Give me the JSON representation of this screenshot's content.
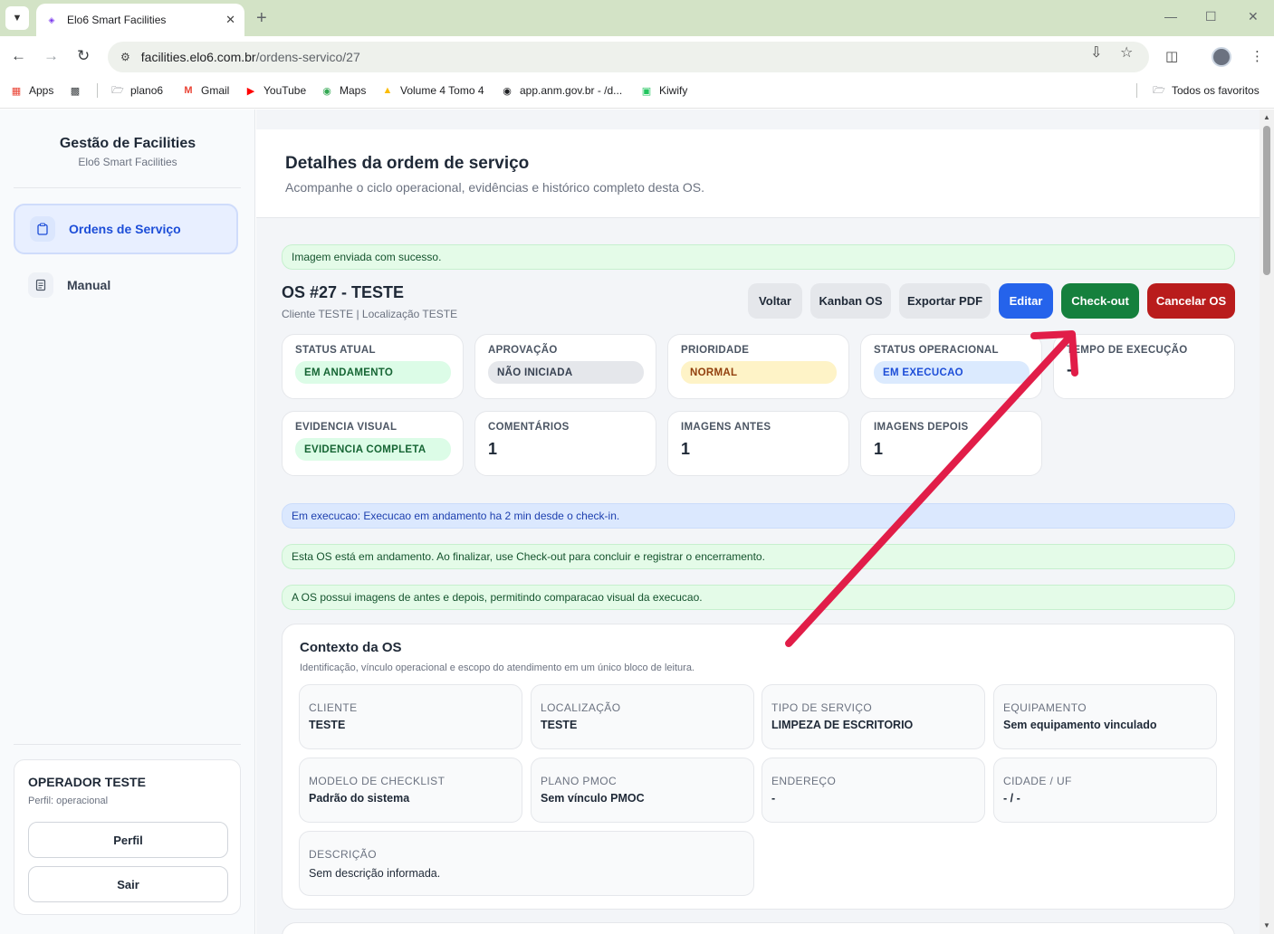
{
  "browser": {
    "tab_title": "Elo6 Smart Facilities",
    "url_host": "facilities.elo6.com.br",
    "url_path": "/ordens-servico/27",
    "bookmarks": [
      {
        "label": "Apps",
        "icon": "apps-grid-icon"
      },
      {
        "label": "",
        "icon": "grid-icon"
      },
      {
        "label": "plano6",
        "icon": "folder-icon"
      },
      {
        "label": "Gmail",
        "icon": "gmail-icon"
      },
      {
        "label": "YouTube",
        "icon": "youtube-icon"
      },
      {
        "label": "Maps",
        "icon": "maps-icon"
      },
      {
        "label": "Volume 4 Tomo 4",
        "icon": "drive-icon"
      },
      {
        "label": "app.anm.gov.br - /d...",
        "icon": "globe-icon"
      },
      {
        "label": "Kiwify",
        "icon": "kiwify-icon"
      }
    ],
    "all_bookmarks": "Todos os favoritos"
  },
  "sidebar": {
    "brand_title": "Gestão de Facilities",
    "brand_subtitle": "Elo6 Smart Facilities",
    "nav": [
      {
        "label": "Ordens de Serviço",
        "active": true
      },
      {
        "label": "Manual",
        "active": false
      }
    ],
    "operator": {
      "name": "OPERADOR TESTE",
      "role": "Perfil: operacional",
      "profile_button": "Perfil",
      "logout_button": "Sair"
    }
  },
  "header": {
    "title": "Detalhes da ordem de serviço",
    "subtitle": "Acompanhe o ciclo operacional, evidências e histórico completo desta OS."
  },
  "alerts": {
    "upload_success": "Imagem enviada com sucesso.",
    "execution": "Em execucao: Execucao em andamento ha 2 min desde o check-in.",
    "in_progress": "Esta OS está em andamento. Ao finalizar, use Check-out para concluir e registrar o encerramento.",
    "images": "A OS possui imagens de antes e depois, permitindo comparacao visual da execucao."
  },
  "os": {
    "title": "OS #27 - TESTE",
    "subtitle": "Cliente TESTE | Localização TESTE",
    "actions": {
      "back": "Voltar",
      "kanban": "Kanban OS",
      "export_pdf": "Exportar PDF",
      "edit": "Editar",
      "checkout": "Check-out",
      "cancel": "Cancelar OS"
    },
    "status_cards": [
      {
        "label": "STATUS ATUAL",
        "value": "EM ANDAMENTO",
        "color": "#dcfce7"
      },
      {
        "label": "APROVAÇÃO",
        "value": "NÃO INICIADA",
        "color": "#e5e7eb"
      },
      {
        "label": "PRIORIDADE",
        "value": "NORMAL",
        "color": "#fef3c7"
      },
      {
        "label": "STATUS OPERACIONAL",
        "value": "EM EXECUCAO",
        "color": "#dbeafe"
      },
      {
        "label": "TEMPO DE EXECUÇÃO",
        "value": "-"
      }
    ],
    "evidence_cards": [
      {
        "label": "EVIDENCIA VISUAL",
        "value": "EVIDENCIA COMPLETA"
      },
      {
        "label": "COMENTÁRIOS",
        "value": "1"
      },
      {
        "label": "IMAGENS ANTES",
        "value": "1"
      },
      {
        "label": "IMAGENS DEPOIS",
        "value": "1"
      }
    ]
  },
  "context": {
    "title": "Contexto da OS",
    "subtitle": "Identificação, vínculo operacional e escopo do atendimento em um único bloco de leitura.",
    "fields": [
      {
        "label": "CLIENTE",
        "value": "TESTE"
      },
      {
        "label": "LOCALIZAÇÃO",
        "value": "TESTE"
      },
      {
        "label": "TIPO DE SERVIÇO",
        "value": "LIMPEZA DE ESCRITORIO"
      },
      {
        "label": "EQUIPAMENTO",
        "value": "Sem equipamento vinculado"
      },
      {
        "label": "MODELO DE CHECKLIST",
        "value": "Padrão do sistema"
      },
      {
        "label": "PLANO PMOC",
        "value": "Sem vínculo PMOC"
      },
      {
        "label": "ENDEREÇO",
        "value": "-"
      },
      {
        "label": "CIDADE / UF",
        "value": "- / -"
      },
      {
        "label": "DESCRIÇÃO",
        "value": "Sem descrição informada."
      }
    ]
  },
  "colors": {
    "primary": "#2563eb",
    "success": "#15803d",
    "danger": "#b91c1c",
    "annotation_arrow": "#e11d48"
  }
}
